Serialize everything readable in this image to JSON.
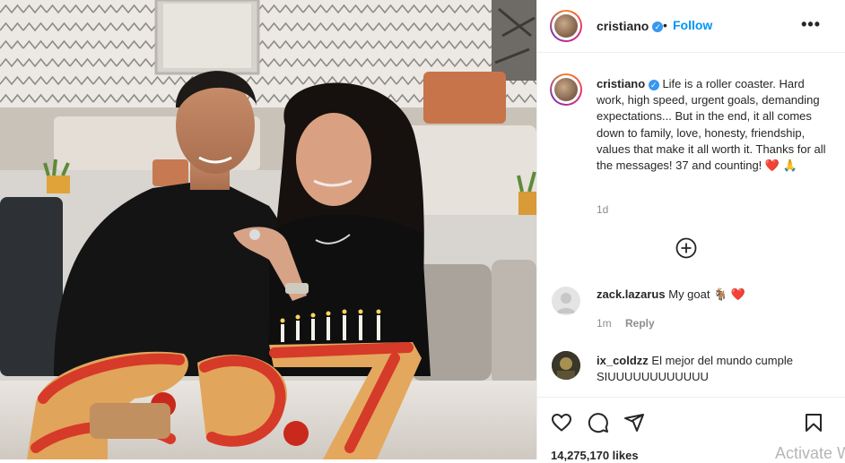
{
  "post": {
    "username": "cristiano",
    "follow_label": "Follow",
    "separator": "•",
    "more_label": "•••",
    "caption_text": "Life is a roller coaster. Hard work, high speed, urgent goals, demanding expectations... But in the end, it all comes down to family, love, honesty, friendship, values that make it all worth it. Thanks for all the messages! 37 and counting!",
    "caption_emoji": "❤️ 🙏",
    "time_ago": "1d",
    "likes": "14,275,170 likes",
    "verified_mark": "✓"
  },
  "comments": [
    {
      "username": "zack.lazarus",
      "text": "My goat 🐐 ❤️",
      "time": "1m",
      "reply_label": "Reply"
    },
    {
      "username": "ix_coldzz",
      "text": "El mejor del mundo cumple SIUUUUUUUUUUUU"
    }
  ],
  "icons": {
    "like": "heart-icon",
    "comment": "comment-icon",
    "share": "paper-plane-icon",
    "save": "bookmark-icon",
    "load_more": "plus-circle-icon",
    "more": "more-options-icon"
  },
  "colors": {
    "follow_blue": "#0095f6",
    "verified_blue": "#3897f0",
    "muted_text": "#8e8e8e",
    "heart_red": "#ed4956"
  },
  "watermark": "Activate W"
}
